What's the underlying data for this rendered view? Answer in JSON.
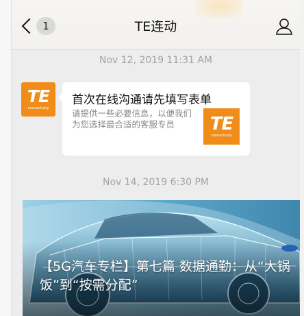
{
  "nav": {
    "unread_count": "1",
    "title": "TE连动"
  },
  "messages": {
    "timestamp_1": "Nov 12, 2019 11:31 AM",
    "timestamp_2": "Nov 14, 2019 6:30 PM"
  },
  "sender": {
    "logo_text": "TE",
    "logo_subtext": "connectivity"
  },
  "card": {
    "title": "首次在线沟通请先填写表单",
    "description": "请提供一些必要信息，以便我们为您选择最合适的客服专员",
    "thumb_text": "TE",
    "thumb_subtext": "connectivity"
  },
  "article": {
    "title": "【5G汽车专栏】第七篇 数据通勤：从“大锅饭”到“按需分配”"
  },
  "colors": {
    "brand_orange": "#f08c1a",
    "background": "#ededed",
    "bubble": "#ffffff"
  }
}
